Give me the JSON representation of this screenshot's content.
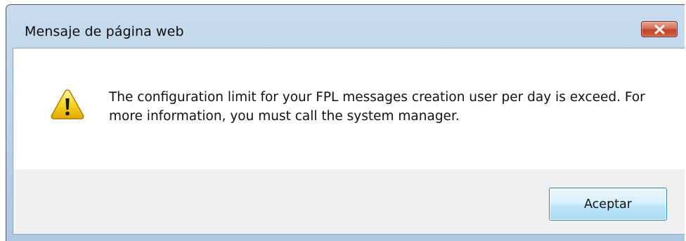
{
  "dialog": {
    "title": "Mensaje de página web",
    "message": "The configuration limit for your FPL messages creation user per day is exceed. For more information, you must call the system manager.",
    "ok_label": "Aceptar",
    "icon": "warning-icon",
    "close_icon": "close-icon"
  },
  "colors": {
    "close_button": "#c7503a",
    "ok_button_border": "#3c7fb1",
    "warning_icon": "#f5d20b"
  }
}
